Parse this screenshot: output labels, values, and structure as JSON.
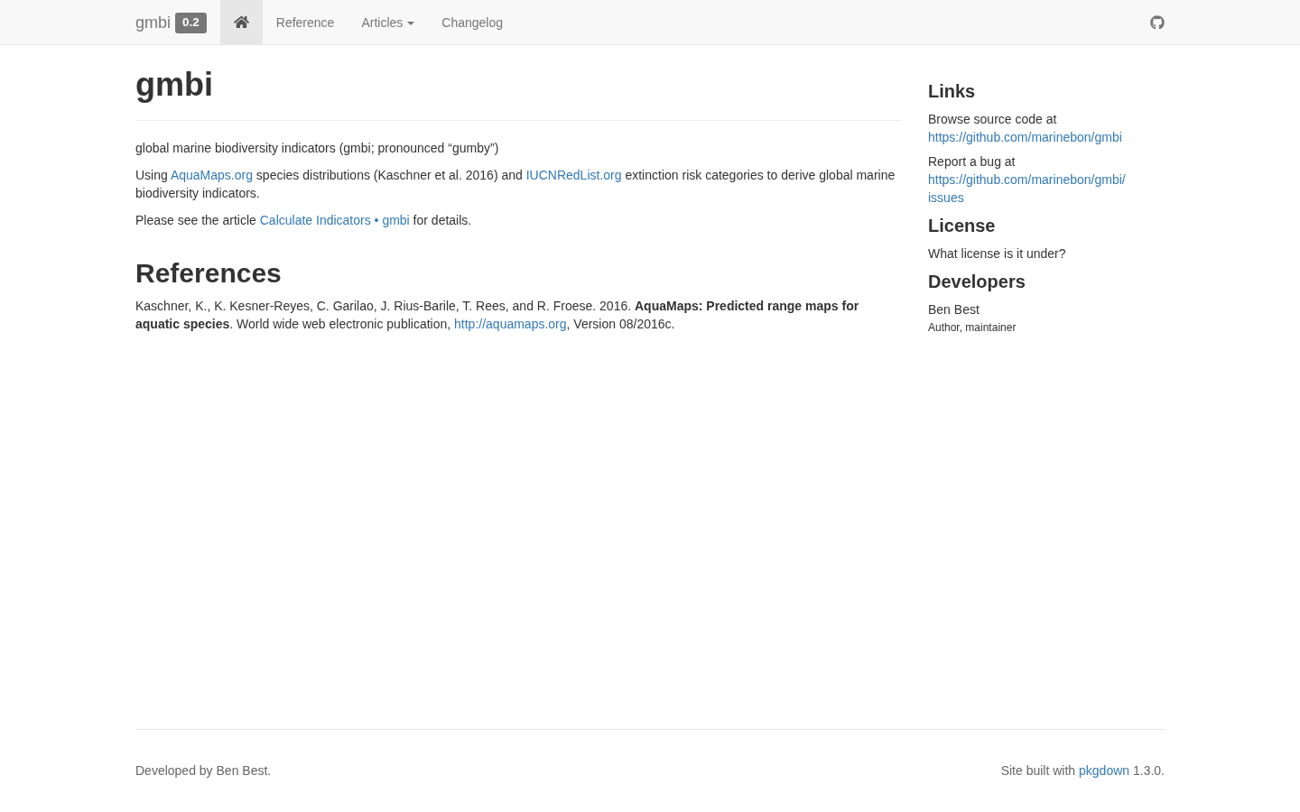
{
  "navbar": {
    "brand": "gmbi",
    "version": "0.2",
    "items": [
      {
        "kind": "home",
        "selected": true
      },
      {
        "kind": "link",
        "label": "Reference",
        "selected": false
      },
      {
        "kind": "dropdown",
        "label": "Articles",
        "selected": false
      },
      {
        "kind": "link",
        "label": "Changelog",
        "selected": false
      }
    ]
  },
  "main": {
    "title": "gmbi",
    "paragraphs": [
      {
        "segments": [
          {
            "kind": "text",
            "text": "global marine biodiversity indicators (gmbi; pronounced “gumby”)"
          }
        ]
      },
      {
        "segments": [
          {
            "kind": "text",
            "text": "Using "
          },
          {
            "kind": "link",
            "text": "AquaMaps.org"
          },
          {
            "kind": "text",
            "text": " species distributions (Kaschner et al. 2016) and "
          },
          {
            "kind": "link",
            "text": "IUCNRedList.org"
          },
          {
            "kind": "text",
            "text": " extinction risk categories to derive global marine biodiversity indicators."
          }
        ]
      },
      {
        "segments": [
          {
            "kind": "text",
            "text": "Please see the article "
          },
          {
            "kind": "link",
            "text": "Calculate Indicators • gmbi"
          },
          {
            "kind": "text",
            "text": " for details."
          }
        ]
      }
    ],
    "references": {
      "heading": "References",
      "entries": [
        {
          "segments": [
            {
              "kind": "text",
              "text": "Kaschner, K., K. Kesner-Reyes, C. Garilao, J. Rius-Barile, T. Rees, and R. Froese. 2016. **AquaMaps: Predicted range maps for aquatic species**. World wide web electronic publication, "
            },
            {
              "kind": "link",
              "text": "http://aquamaps.org"
            },
            {
              "kind": "text",
              "text": ", Version 08/2016c."
            }
          ]
        }
      ]
    }
  },
  "sidebar": {
    "sections": [
      {
        "heading": "Links",
        "items": [
          {
            "kind": "link",
            "caption": "Browse source code at",
            "link": "https://github.com/marinebon/gmbi"
          },
          {
            "kind": "link",
            "caption": "Report a bug at",
            "link": "https://github.com/marinebon/gmbi/issues"
          }
        ]
      },
      {
        "heading": "License",
        "items": [
          {
            "kind": "text",
            "caption": "What license is it under?"
          }
        ]
      },
      {
        "heading": "Developers",
        "items": [
          {
            "kind": "person",
            "caption": "Ben Best",
            "role": "Author, maintainer"
          }
        ]
      }
    ]
  },
  "footer": {
    "left": "Developed by Ben Best.",
    "right": [
      {
        "kind": "text",
        "text": "Site built with "
      },
      {
        "kind": "link",
        "text": "pkgdown"
      },
      {
        "kind": "text",
        "text": " 1.3.0."
      }
    ]
  }
}
